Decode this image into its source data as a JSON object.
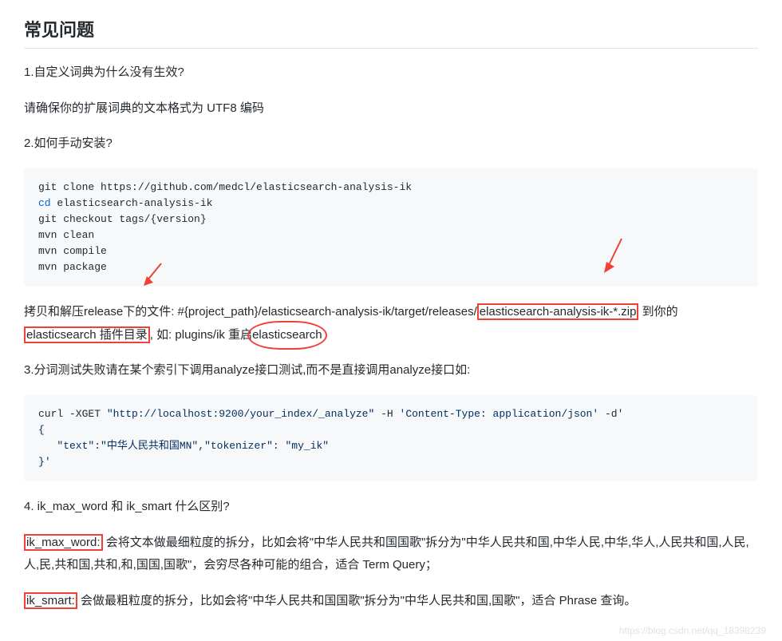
{
  "heading": "常见问题",
  "q1": "1.自定义词典为什么没有生效?",
  "a1": "请确保你的扩展词典的文本格式为 UTF8 编码",
  "q2": "2.如何手动安装?",
  "code1": {
    "l1a": "git clone https://github.com/medcl/elasticsearch-analysis-ik",
    "l2kw": "cd",
    "l2b": " elasticsearch-analysis-ik",
    "l3a": "git checkout tags/{version}",
    "l4": "mvn clean",
    "l5": "mvn compile",
    "l6": "mvn package"
  },
  "p3_a": "拷贝和解压release下的文件: #{project_path}/elasticsearch-analysis-ik/target/releases/",
  "p3_b": "elasticsearch-analysis-ik-*.zip",
  "p3_c": " 到你的",
  "p3_d": "elasticsearch 插件目录",
  "p3_e": ", 如: plugins/ik 重启",
  "p3_f": "elasticsearch",
  "q3": "3.分词测试失败请在某个索引下调用analyze接口测试,而不是直接调用analyze接口如:",
  "code2": {
    "l1a": "curl -XGET ",
    "l1url": "\"http://localhost:9200/your_index/_analyze\"",
    "l1b": " -H ",
    "l1hdr": "'Content-Type: application/json'",
    "l1c": " -d",
    "l1d": "'",
    "l2": "{",
    "l3a": "   ",
    "l3b": "\"text\"",
    "l3c": ":",
    "l3d": "\"中华人民共和国MN\"",
    "l3e": ",",
    "l3f": "\"tokenizer\"",
    "l3g": ": ",
    "l3h": "\"my_ik\"",
    "l4": "}",
    "l4b": "'"
  },
  "q4": "4. ik_max_word 和 ik_smart 什么区别?",
  "p5_a": "ik_max_word:",
  "p5_b": " 会将文本做最细粒度的拆分，比如会将\"中华人民共和国国歌\"拆分为\"中华人民共和国,中华人民,中华,华人,人民共和国,人民,人,民,共和国,共和,和,国国,国歌\"，会穷尽各种可能的组合，适合 Term Query；",
  "p6_a": "ik_smart:",
  "p6_b": " 会做最粗粒度的拆分，比如会将\"中华人民共和国国歌\"拆分为\"中华人民共和国,国歌\"，适合 Phrase 查询。",
  "watermark": "https://blog.csdn.net/qq_18398239"
}
